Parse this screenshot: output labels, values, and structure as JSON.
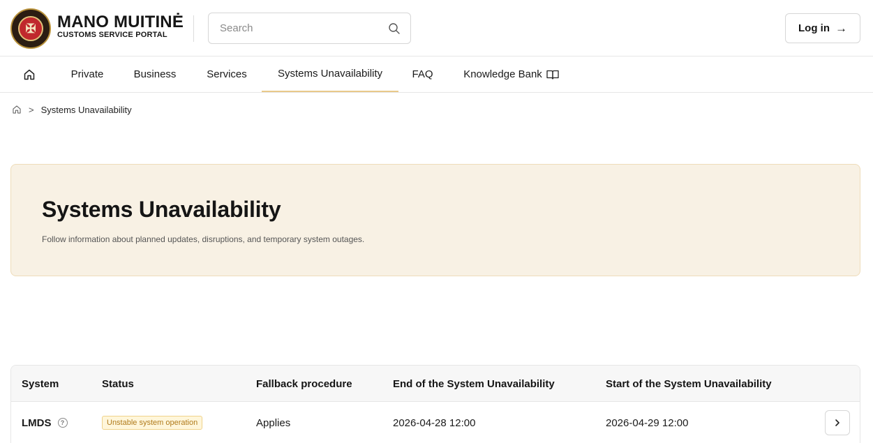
{
  "header": {
    "brand_title": "MANO MUITINĖ",
    "brand_subtitle": "CUSTOMS SERVICE PORTAL",
    "search_placeholder": "Search",
    "login_label": "Log in",
    "login_arrow": "→"
  },
  "nav": {
    "items": [
      {
        "label": "Private"
      },
      {
        "label": "Business"
      },
      {
        "label": "Services"
      },
      {
        "label": "Systems Unavailability",
        "active": true
      },
      {
        "label": "FAQ"
      },
      {
        "label": "Knowledge Bank"
      }
    ],
    "accent_color": "#e9c98a"
  },
  "breadcrumb": {
    "separator": ">",
    "current": "Systems Unavailability"
  },
  "hero": {
    "title": "Systems Unavailability",
    "description": "Follow information about planned updates, disruptions, and temporary system outages.",
    "background": "#f8f1e4"
  },
  "table": {
    "columns": [
      "System",
      "Status",
      "Fallback procedure",
      "End of the System Unavailability",
      "Start of the System Unavailability"
    ],
    "rows": [
      {
        "system": "LMDS",
        "status": "Unstable system operation",
        "fallback": "Applies",
        "end": "2026-04-28 12:00",
        "start": "2026-04-29 12:00"
      }
    ]
  },
  "icons": [
    "emblem-icon",
    "search-icon",
    "arrow-right-icon",
    "home-icon",
    "book-icon",
    "chevron-right-icon",
    "help-circle-icon"
  ]
}
